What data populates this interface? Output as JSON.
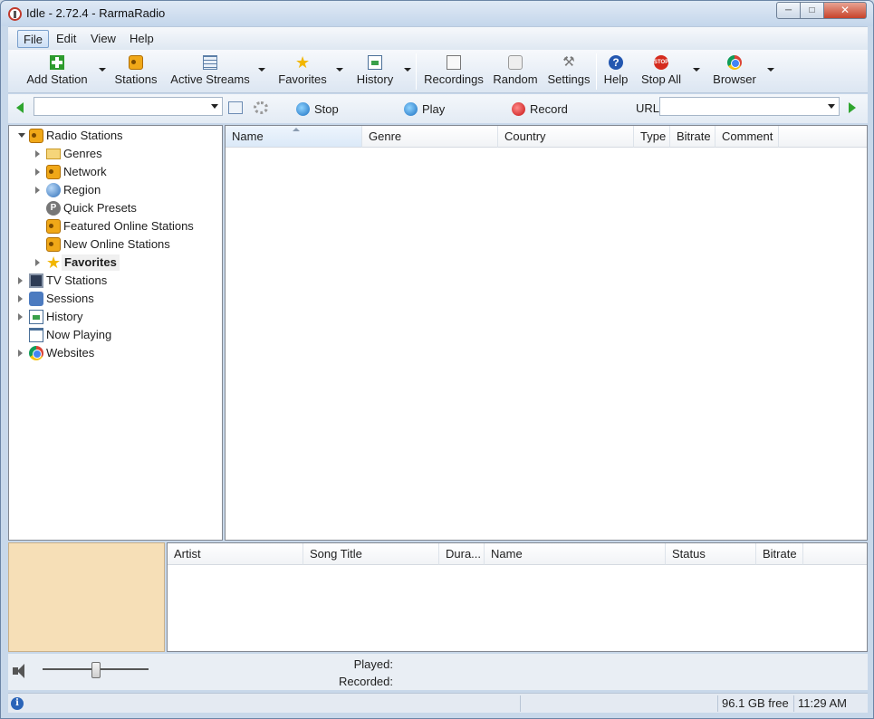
{
  "window": {
    "title": "Idle - 2.72.4 - RarmaRadio"
  },
  "menu": [
    "File",
    "Edit",
    "View",
    "Help"
  ],
  "toolbar": {
    "add_station": "Add Station",
    "stations": "Stations",
    "active_streams": "Active Streams",
    "favorites": "Favorites",
    "history": "History",
    "recordings": "Recordings",
    "random": "Random",
    "settings": "Settings",
    "help": "Help",
    "stop_all": "Stop All",
    "browser": "Browser"
  },
  "transport": {
    "stop": "Stop",
    "play": "Play",
    "record": "Record",
    "url_label": "URL",
    "url_value": "",
    "search_value": ""
  },
  "tree": {
    "root": "Radio Stations",
    "children": [
      "Genres",
      "Network",
      "Region",
      "Quick Presets",
      "Featured Online Stations",
      "New Online Stations",
      "Favorites"
    ],
    "top": [
      "TV Stations",
      "Sessions",
      "History",
      "Now Playing",
      "Websites"
    ]
  },
  "grid": {
    "columns": [
      "Name",
      "Genre",
      "Country",
      "Type",
      "Bitrate",
      "Comment"
    ]
  },
  "tracks": {
    "columns": [
      "Artist",
      "Song Title",
      "Dura...",
      "Name",
      "Status",
      "Bitrate"
    ]
  },
  "player": {
    "played_label": "Played:",
    "recorded_label": "Recorded:",
    "volume": 0.5
  },
  "status": {
    "free_space": "96.1 GB free",
    "time": "11:29 AM"
  }
}
